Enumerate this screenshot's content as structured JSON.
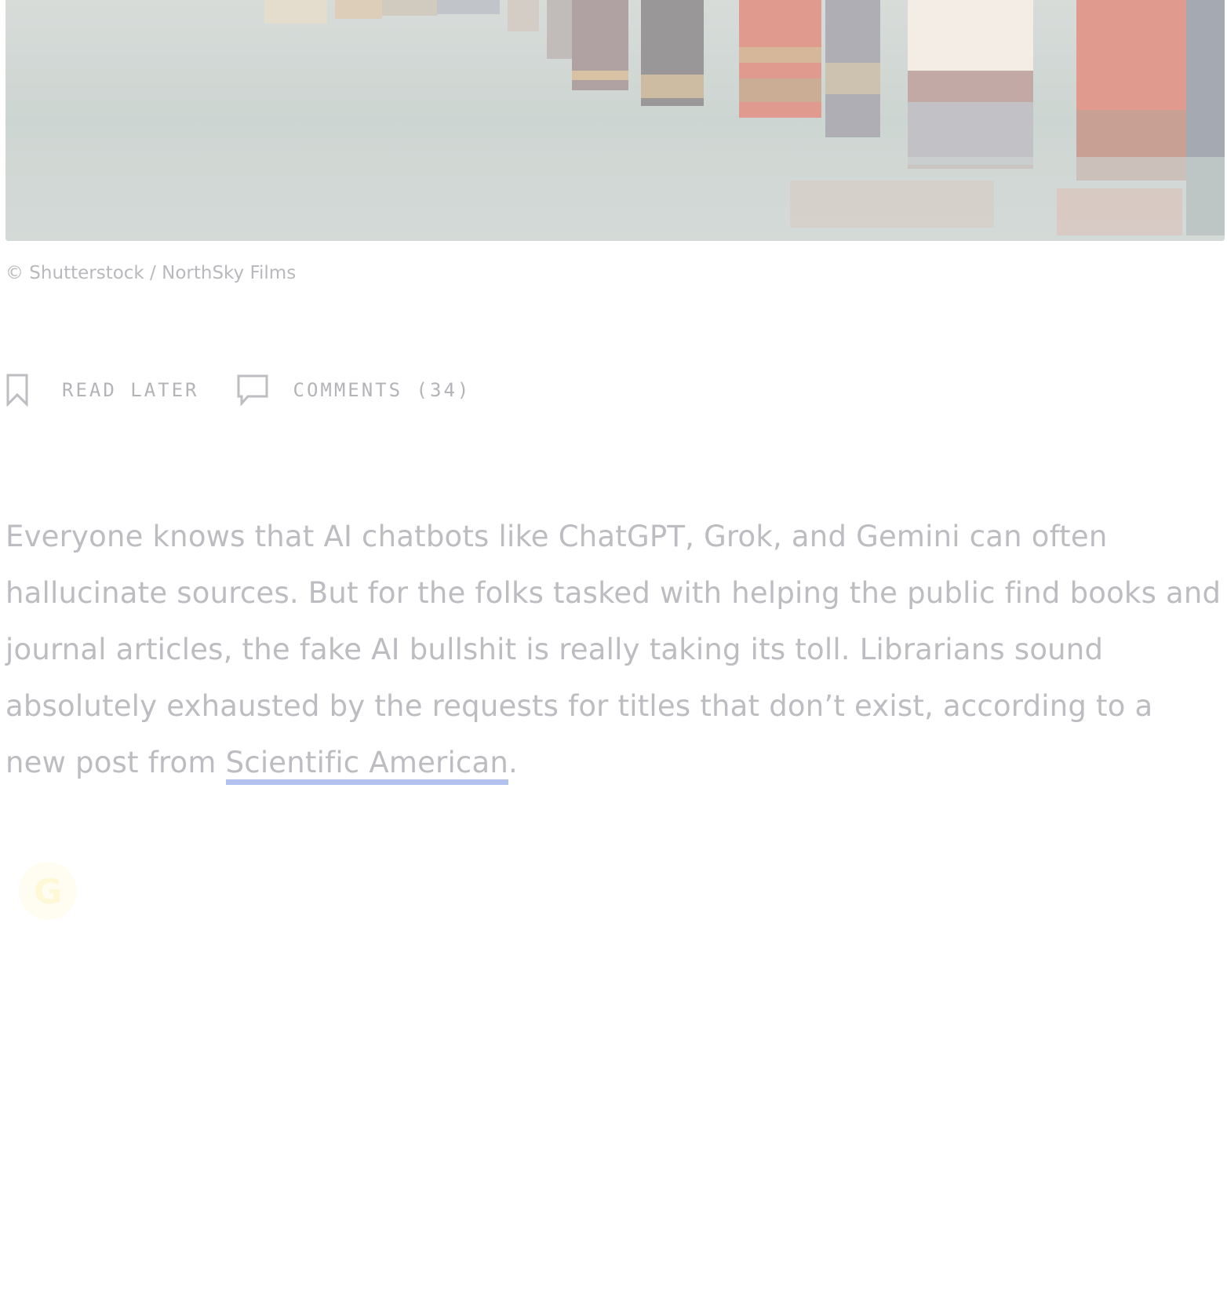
{
  "hero": {
    "alt": "Antique leather-bound books on a shelf",
    "caption": "© Shutterstock / NorthSky Films"
  },
  "actions": {
    "read_later_label": "READ LATER",
    "comments_label": "COMMENTS (34)"
  },
  "article": {
    "intro_text": "Everyone knows that AI chatbots like ChatGPT, Grok, and Gemini can often hallucinate sources. But for the folks tasked with helping the public find books and journal articles, the fake AI bullshit is really taking its toll. Librarians sound absolutely exhausted by the requests for titles that don’t exist, according to a new post from",
    "link_text": "Scientific American",
    "trailing_text": "."
  },
  "badge": {
    "letter": "G"
  },
  "colors": {
    "text": "#bcbcc1",
    "link_underline": "#b2c1f0",
    "icon": "#bdbdc2"
  }
}
